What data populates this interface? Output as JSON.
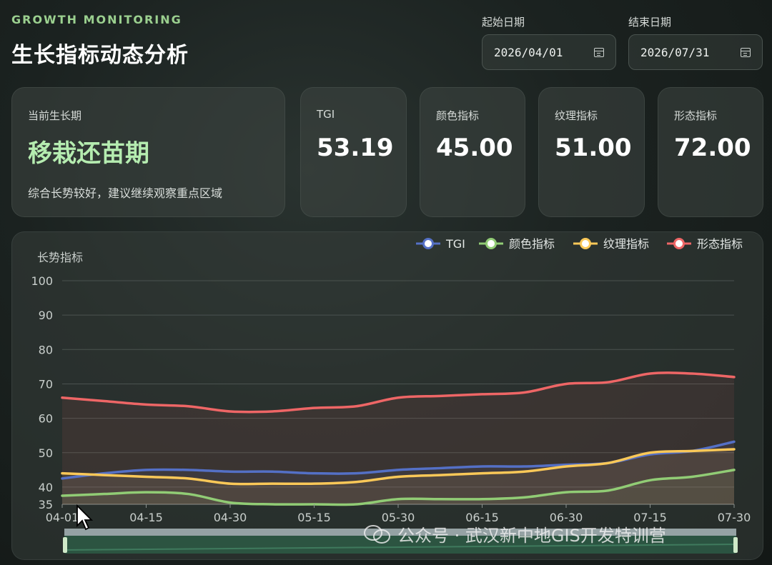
{
  "header": {
    "eyebrow": "GROWTH MONITORING",
    "title": "生长指标动态分析"
  },
  "date_range": {
    "start_label": "起始日期",
    "start_value": "2026/04/01",
    "end_label": "结束日期",
    "end_value": "2026/07/31"
  },
  "stage_card": {
    "label": "当前生长期",
    "value": "移栽还苗期",
    "description": "综合长势较好，建议继续观察重点区域"
  },
  "metric_cards": [
    {
      "label": "TGI",
      "value": "53.19"
    },
    {
      "label": "颜色指标",
      "value": "45.00"
    },
    {
      "label": "纹理指标",
      "value": "51.00"
    },
    {
      "label": "形态指标",
      "value": "72.00"
    }
  ],
  "watermark": "公众号 · 武汉新中地GIS开发特训营",
  "colors": {
    "accent_green": "#9bd08f",
    "tgi": "#5470c6",
    "color_index": "#91cc75",
    "texture_index": "#fac858",
    "shape_index": "#ee6666"
  },
  "chart_data": {
    "type": "line",
    "ylabel": "长势指标",
    "ylim": [
      35,
      100
    ],
    "yticks": [
      35,
      40,
      50,
      60,
      70,
      80,
      90,
      100
    ],
    "x": [
      "04-01",
      "04-08",
      "04-15",
      "04-22",
      "04-30",
      "05-07",
      "05-15",
      "05-22",
      "05-30",
      "06-07",
      "06-15",
      "06-22",
      "06-30",
      "07-07",
      "07-15",
      "07-22",
      "07-30"
    ],
    "xtick_labels": [
      "04-01",
      "04-15",
      "04-30",
      "05-15",
      "05-30",
      "06-15",
      "06-30",
      "07-15",
      "07-30"
    ],
    "legend_position": "top-right",
    "grid": true,
    "series": [
      {
        "name": "TGI",
        "color": "#5470c6",
        "values": [
          42.5,
          44.0,
          45.0,
          45.0,
          44.5,
          44.5,
          44.0,
          44.0,
          45.0,
          45.5,
          46.0,
          46.0,
          46.5,
          47.0,
          49.5,
          50.5,
          53.2
        ]
      },
      {
        "name": "颜色指标",
        "color": "#91cc75",
        "values": [
          37.5,
          38.0,
          38.5,
          38.0,
          35.5,
          35.0,
          34.5,
          35.0,
          36.5,
          36.5,
          36.5,
          37.0,
          38.5,
          39.0,
          42.0,
          43.0,
          45.0
        ]
      },
      {
        "name": "纹理指标",
        "color": "#fac858",
        "values": [
          44.0,
          43.5,
          43.0,
          42.5,
          41.0,
          41.0,
          41.0,
          41.5,
          43.0,
          43.5,
          44.0,
          44.5,
          46.0,
          47.0,
          50.0,
          50.5,
          51.0
        ]
      },
      {
        "name": "形态指标",
        "color": "#ee6666",
        "values": [
          66.0,
          65.0,
          64.0,
          63.5,
          62.0,
          62.0,
          63.0,
          63.5,
          66.0,
          66.5,
          67.0,
          67.5,
          70.0,
          70.5,
          73.0,
          73.0,
          72.0
        ]
      }
    ]
  }
}
